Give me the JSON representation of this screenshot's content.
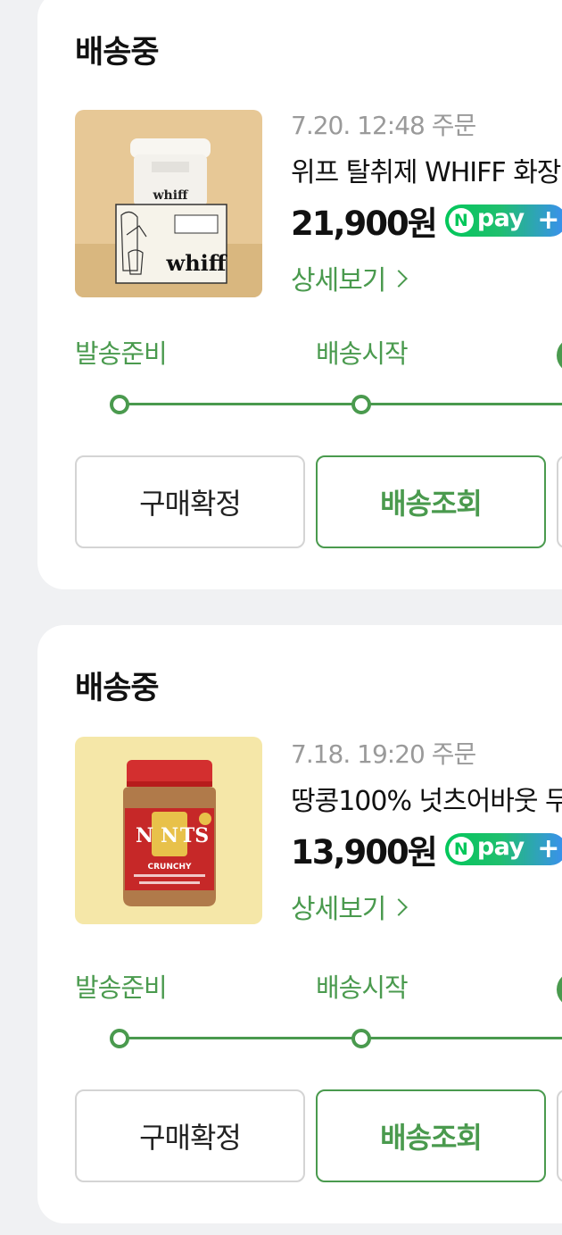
{
  "orders": [
    {
      "status": "배송중",
      "order_date": "7.20. 12:48 주문",
      "product_name": "위프 탈취제 WHIFF 화장",
      "price": "21,900원",
      "npay": {
        "n": "N",
        "text": "pay",
        "plus": "+"
      },
      "detail_label": "상세보기",
      "steps": [
        "발송준비",
        "배송시작"
      ],
      "buttons": {
        "confirm": "구매확정",
        "track": "배송조회"
      },
      "thumbnail": {
        "product": "whiff",
        "label": "whiff"
      }
    },
    {
      "status": "배송중",
      "order_date": "7.18. 19:20 주문",
      "product_name": "땅콩100% 넛츠어바웃 무",
      "price": "13,900원",
      "npay": {
        "n": "N",
        "text": "pay",
        "plus": "+"
      },
      "detail_label": "상세보기",
      "steps": [
        "발송준비",
        "배송시작"
      ],
      "buttons": {
        "confirm": "구매확정",
        "track": "배송조회"
      },
      "thumbnail": {
        "product": "nuts",
        "label": "NUTS",
        "sub": "CRUNCHY"
      }
    }
  ],
  "colors": {
    "accent_green": "#4a9a4e",
    "npay_green": "#03c75a",
    "npay_blue": "#3b8ef3",
    "background": "#f0f1f3"
  }
}
